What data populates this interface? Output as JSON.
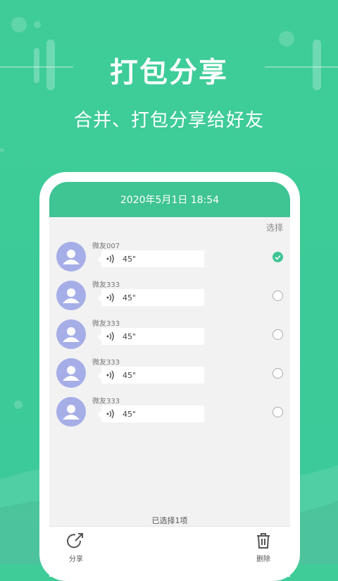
{
  "hero": {
    "title": "打包分享",
    "subtitle": "合并、打包分享给好友"
  },
  "phone": {
    "header_time": "2020年5月1日  18:54",
    "select_label": "选择",
    "messages": [
      {
        "name": "微友007",
        "duration": "45\"",
        "checked": true
      },
      {
        "name": "微友333",
        "duration": "45\"",
        "checked": false
      },
      {
        "name": "微友333",
        "duration": "45\"",
        "checked": false
      },
      {
        "name": "微友333",
        "duration": "45\"",
        "checked": false
      },
      {
        "name": "微友333",
        "duration": "45\"",
        "checked": false
      }
    ],
    "selected_count": "已选择1项",
    "share_label": "分享",
    "delete_label": "删除"
  },
  "colors": {
    "background": "#3fcc98",
    "header": "#3fc493",
    "avatar": "#a6aee8"
  },
  "icons": [
    "user-icon",
    "sound-wave-icon",
    "check-icon",
    "share-icon",
    "trash-icon"
  ]
}
